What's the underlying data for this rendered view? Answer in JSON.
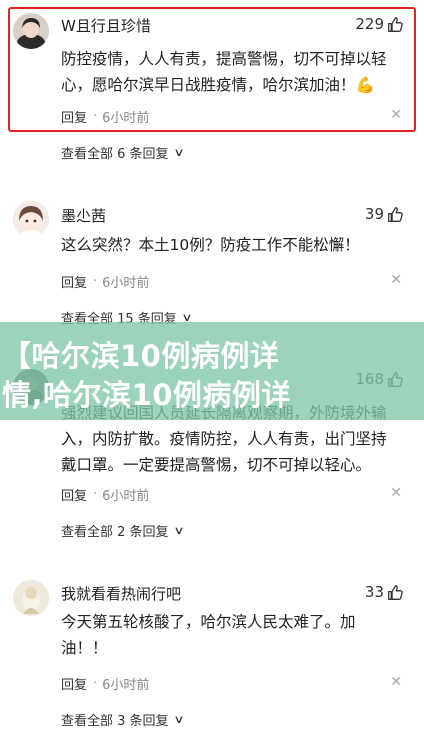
{
  "comments": [
    {
      "username": "W且行且珍惜",
      "likes": "229",
      "text_lines": [
        "防控疫情，人人有责，提高警惕，切不可掉以轻",
        "心，愿哈尔滨早日战胜疫情，哈尔滨加油！💪"
      ],
      "reply_label": "回复",
      "time": "6小时前",
      "replies": "查看全部 6 条回复"
    },
    {
      "username": "墨尐茜",
      "likes": "39",
      "text_lines": [
        "这么突然？本土10例？防疫工作不能松懈！"
      ],
      "reply_label": "回复",
      "time": "6小时前",
      "replies": "查看全部 15 条回复"
    },
    {
      "username": "",
      "likes": "168",
      "text_lines": [
        "强烈建议回国人员延长隔离观察期，外防境外输",
        "入，内防扩散。疫情防控，人人有责，出门坚持",
        "戴口罩。一定要提高警惕，切不可掉以轻心。"
      ],
      "reply_label": "回复",
      "time": "6小时前",
      "replies": "查看全部 2 条回复"
    },
    {
      "username": "我就看看热闹行吧",
      "likes": "33",
      "text_lines": [
        "今天第五轮核酸了，哈尔滨人民太难了。加",
        "油！！"
      ],
      "reply_label": "回复",
      "time": "6小时前",
      "replies": "查看全部 3 条回复"
    }
  ],
  "banner": {
    "line1": "【哈尔滨10例病例详",
    "line2": "情,哈尔滨10例病例详"
  },
  "colors": {
    "highlight": "#e02424",
    "banner": "#80c6a8"
  },
  "icons": {
    "like": "thumbs-up-icon",
    "close": "close-icon",
    "chevron": "chevron-down-icon"
  }
}
